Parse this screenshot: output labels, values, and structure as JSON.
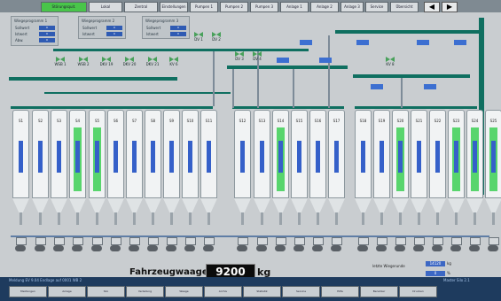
{
  "topbar": {
    "buttons": [
      "Störungsquit.",
      "Lokal",
      "Zentral",
      "Einstellungen",
      "Pumpen 1",
      "Pumpen 2",
      "Pumpen 3",
      "Anlage 1",
      "Anlage 2",
      "Anlage 3",
      "Service",
      "Übersicht"
    ],
    "nav_prev": "◀",
    "nav_next": "▶"
  },
  "info_boxes": [
    {
      "title": "Wiegeprogramm 1",
      "rows": [
        {
          "label": "Sollwert",
          "value": "0"
        },
        {
          "label": "Istwert",
          "value": "0"
        },
        {
          "label": "Abw.",
          "value": "0"
        }
      ]
    },
    {
      "title": "Wiegeprogramm 2",
      "rows": [
        {
          "label": "Sollwert",
          "value": "0"
        },
        {
          "label": "Istwert",
          "value": "0"
        }
      ]
    },
    {
      "title": "Wiegeprogramm 3",
      "rows": [
        {
          "label": "Sollwert",
          "value": "0"
        },
        {
          "label": "Istwert",
          "value": "0"
        }
      ]
    }
  ],
  "valves": [
    {
      "label": "DV 1"
    },
    {
      "label": "DV 2"
    },
    {
      "label": "DV 3"
    },
    {
      "label": "DV 4"
    },
    {
      "label": "WSB 1"
    },
    {
      "label": "WSB 2"
    },
    {
      "label": "DKV 19"
    },
    {
      "label": "DKV 20"
    },
    {
      "label": "DKV 21"
    },
    {
      "label": "KV 6"
    },
    {
      "label": "KV 8"
    }
  ],
  "silos": [
    {
      "num": "S1",
      "fill": false
    },
    {
      "num": "S2",
      "fill": false
    },
    {
      "num": "S3",
      "fill": false
    },
    {
      "num": "S4",
      "fill": true
    },
    {
      "num": "S5",
      "fill": true
    },
    {
      "num": "S6",
      "fill": false
    },
    {
      "num": "S7",
      "fill": false
    },
    {
      "num": "S8",
      "fill": false
    },
    {
      "num": "S9",
      "fill": false
    },
    {
      "num": "S10",
      "fill": false
    },
    {
      "num": "S11",
      "fill": false
    },
    {
      "num": "S12",
      "fill": false
    },
    {
      "num": "S13",
      "fill": false
    },
    {
      "num": "S14",
      "fill": true
    },
    {
      "num": "S15",
      "fill": false
    },
    {
      "num": "S16",
      "fill": false
    },
    {
      "num": "S17",
      "fill": false
    },
    {
      "num": "S18",
      "fill": false
    },
    {
      "num": "S19",
      "fill": false
    },
    {
      "num": "S20",
      "fill": true
    },
    {
      "num": "S21",
      "fill": false
    },
    {
      "num": "S22",
      "fill": false
    },
    {
      "num": "S23",
      "fill": true
    },
    {
      "num": "S24",
      "fill": true
    },
    {
      "num": "S25",
      "fill": true
    }
  ],
  "weighing": {
    "label": "Fahrzeugwaage",
    "value": "9200",
    "unit": "kg"
  },
  "last_weighing": {
    "label": "letzte Wiegerunde",
    "value": "14120",
    "unit": "kg"
  },
  "status_value": {
    "value": "0",
    "unit": "%"
  },
  "footer": {
    "status_line": "Meldung EV 9.04 Endlage auf   0001 WB 2",
    "tabs": [
      "Meldungen",
      "Anlage",
      "Silo",
      "Verladung",
      "Waage",
      "Archiv",
      "Statistik",
      "Service",
      "Hilfe",
      "Benutzer",
      "Drucken"
    ],
    "version": "Master Silo 2.1"
  },
  "colors": {
    "panel": "#c9cdd0",
    "pipe": "#0f6f60",
    "fill_green": "#58d56d",
    "value_blue": "#3c67c4"
  }
}
